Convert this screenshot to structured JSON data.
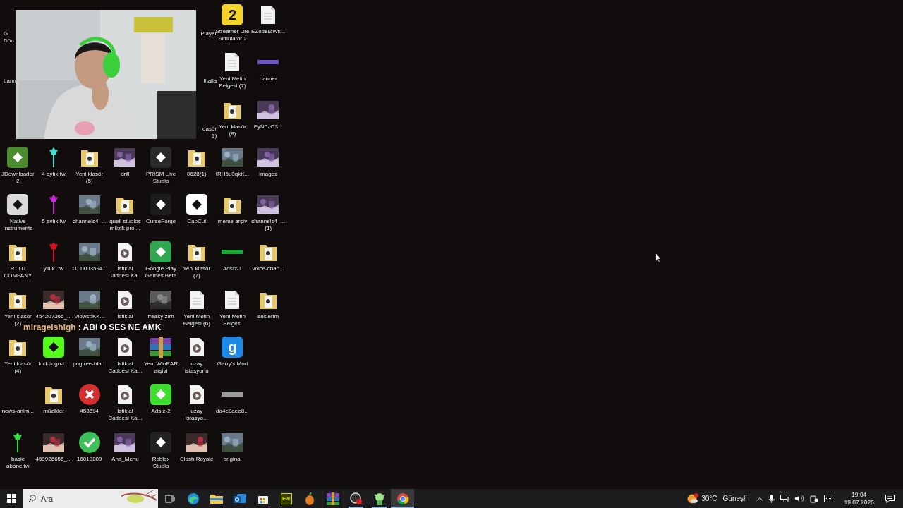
{
  "desktop": {
    "rows": [
      [
        {
          "kind": "clipped-left",
          "label": "G\nDön"
        },
        {
          "kind": "covered"
        },
        {
          "kind": "covered"
        },
        {
          "kind": "covered"
        },
        {
          "kind": "covered"
        },
        {
          "kind": "clipped-right",
          "label": "Player"
        },
        {
          "kind": "tile",
          "color": "#f2d32b",
          "glyph": "2",
          "label": "Streamer Life\nSimulator 2"
        },
        {
          "kind": "textfile",
          "label": "EZddelZWk..."
        }
      ],
      [
        {
          "kind": "clipped-left",
          "label": "bann"
        },
        {
          "kind": "covered"
        },
        {
          "kind": "covered"
        },
        {
          "kind": "covered"
        },
        {
          "kind": "covered"
        },
        {
          "kind": "clipped-right",
          "label": "lhalla"
        },
        {
          "kind": "textfile",
          "label": "Yeni Metin\nBelgesi (7)"
        },
        {
          "kind": "banner",
          "color": "#6a4fc7",
          "label": "banner"
        }
      ],
      [
        {
          "kind": "covered"
        },
        {
          "kind": "covered"
        },
        {
          "kind": "covered"
        },
        {
          "kind": "covered"
        },
        {
          "kind": "covered"
        },
        {
          "kind": "clipped-right",
          "label": "dasör\n3)"
        },
        {
          "kind": "folder",
          "label": "Yeni klasör\n(8)"
        },
        {
          "label": "EyN0zO3..."
        }
      ],
      [
        {
          "kind": "tile",
          "color": "#4b8a2e",
          "label": "JDownloader\n2"
        },
        {
          "kind": "trident",
          "color": "#3fe0d0",
          "label": "4 aylık.fw"
        },
        {
          "kind": "folder",
          "label": "Yeni klasör\n(5)"
        },
        {
          "label": "drill"
        },
        {
          "kind": "tile",
          "color": "#2a2a2a",
          "label": "PRISM Live\nStudio"
        },
        {
          "kind": "folder",
          "label": "0628(1)"
        },
        {
          "label": "IRH5u0qkK..."
        },
        {
          "label": "images"
        }
      ],
      [
        {
          "kind": "tile",
          "color": "#d9d9d9",
          "label": "Native\nInstruments"
        },
        {
          "kind": "trident",
          "color": "#d020e0",
          "label": "5 aylık.fw"
        },
        {
          "label": "channels4_..."
        },
        {
          "kind": "folder",
          "label": "quell studios\nmüzik proj..."
        },
        {
          "kind": "tile",
          "color": "#1c1c1c",
          "label": "CurseForge"
        },
        {
          "kind": "tile",
          "color": "#ffffff",
          "label": "CapCut"
        },
        {
          "kind": "folder",
          "label": "meme arşiv"
        },
        {
          "label": "channels4_...\n(1)"
        }
      ],
      [
        {
          "kind": "folder",
          "label": "RTTD\nCOMPANY"
        },
        {
          "kind": "trident",
          "color": "#e01020",
          "label": "yıllık .fw"
        },
        {
          "label": "1100003594..."
        },
        {
          "kind": "video",
          "label": "İstiklal\nCaddesi Ka..."
        },
        {
          "kind": "tile",
          "color": "#2fa84f",
          "label": "Google Play\nGames Beta"
        },
        {
          "kind": "folder",
          "label": "Yeni klasör\n(7)"
        },
        {
          "kind": "banner",
          "color": "#1fa83a",
          "label": "Adsız-1"
        },
        {
          "kind": "folder",
          "label": "voice-chan..."
        }
      ],
      [
        {
          "kind": "folder",
          "label": "Yeni klasör\n(2)"
        },
        {
          "label": "454207366_..."
        },
        {
          "label": "VlowspKK..."
        },
        {
          "kind": "video",
          "label": "İstiklal"
        },
        {
          "label": "freaky zırh"
        },
        {
          "kind": "textfile",
          "label": "Yeni Metin\nBelgesi (6)"
        },
        {
          "kind": "textfile",
          "label": "Yeni Metin\nBelgesi"
        },
        {
          "kind": "folder",
          "label": "seslerim"
        }
      ],
      [
        {
          "kind": "folder",
          "label": "Yeni klasör\n(4)"
        },
        {
          "kind": "tile",
          "color": "#53fc18",
          "label": "kick-logo-i..."
        },
        {
          "label": "pngtree-bla..."
        },
        {
          "kind": "video",
          "label": "İstiklal\nCaddesi Ka..."
        },
        {
          "kind": "archive",
          "label": "Yeni WinRAR\narşivi"
        },
        {
          "kind": "video",
          "label": "uzay\nistasyonu"
        },
        {
          "kind": "tile",
          "color": "#1e88e5",
          "glyph": "g",
          "label": "Garry's Mod"
        }
      ],
      [
        {
          "kind": "none",
          "label": "news-anim..."
        },
        {
          "kind": "folder",
          "label": "müzikler"
        },
        {
          "kind": "cross-circle",
          "color": "#d32f2f",
          "label": "458594"
        },
        {
          "kind": "video",
          "label": "İstiklal\nCaddesi Ka..."
        },
        {
          "kind": "tile",
          "color": "#3ddc2f",
          "label": "Adsız-2"
        },
        {
          "kind": "video",
          "label": "uzay\nistasyo..."
        },
        {
          "kind": "banner",
          "color": "#9a9a9a",
          "label": "da4e8aee8..."
        }
      ],
      [
        {
          "kind": "trident",
          "color": "#30e040",
          "label": "basic\nabone.fw"
        },
        {
          "label": "459926656_..."
        },
        {
          "kind": "check-circle",
          "color": "#3fbf5a",
          "label": "16019809"
        },
        {
          "label": "Ana_Menu"
        },
        {
          "kind": "tile",
          "color": "#222222",
          "label": "Roblox\nStudio"
        },
        {
          "label": "Clash Royale"
        },
        {
          "label": "original"
        }
      ]
    ]
  },
  "chat": {
    "user": "mirageishigh",
    "message": ": ABI O SES NE AMK"
  },
  "taskbar": {
    "search": {
      "placeholder": "Ara"
    },
    "apps": [
      {
        "kind": "taskview",
        "running": false,
        "selected": false
      },
      {
        "kind": "edge",
        "running": false,
        "selected": false
      },
      {
        "kind": "explorer",
        "running": false,
        "selected": false
      },
      {
        "kind": "mail",
        "running": false,
        "selected": false
      },
      {
        "kind": "store",
        "running": false,
        "selected": false
      },
      {
        "kind": "fw",
        "text": "Fw",
        "running": false,
        "selected": false
      },
      {
        "kind": "fruit",
        "running": false,
        "selected": false
      },
      {
        "kind": "archive",
        "running": false,
        "selected": false
      },
      {
        "kind": "recorder",
        "running": true,
        "selected": false
      },
      {
        "kind": "creature",
        "running": true,
        "selected": false
      },
      {
        "kind": "chrome",
        "running": true,
        "selected": true
      }
    ],
    "weather": {
      "temperature": "30°C",
      "condition": "Güneşli"
    },
    "clock": {
      "time": "19:04",
      "date": "19.07.2025"
    }
  }
}
